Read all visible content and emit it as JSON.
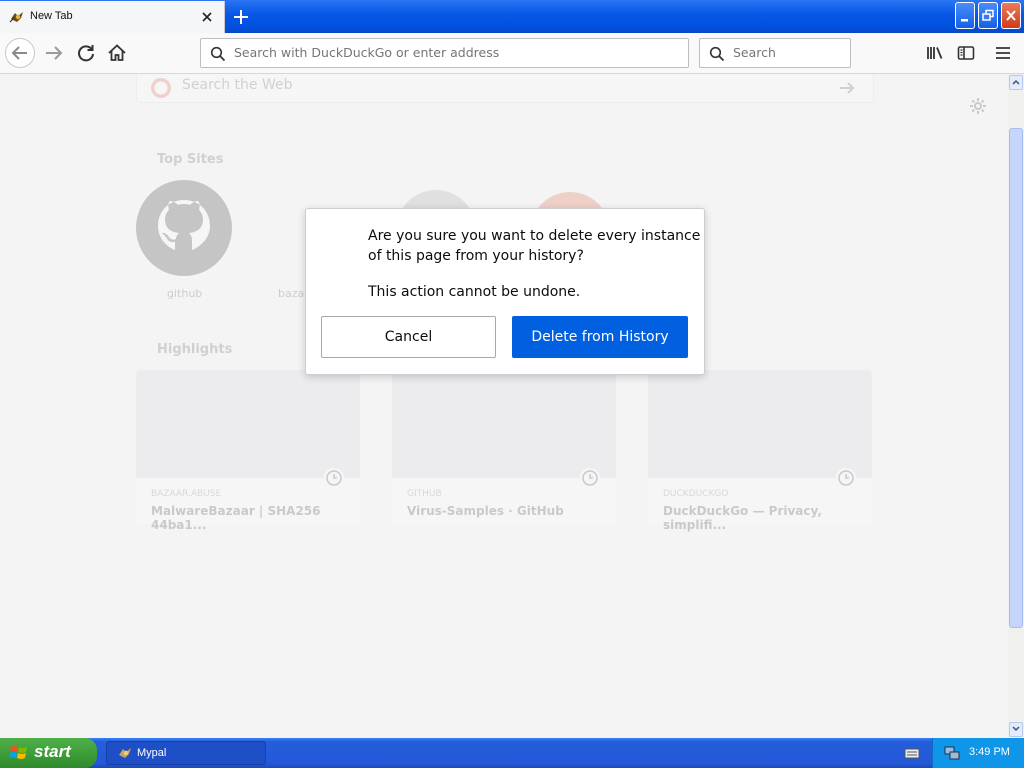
{
  "browser": {
    "tab_title": "New Tab",
    "url_placeholder": "Search with DuckDuckGo or enter address",
    "search_placeholder": "Search"
  },
  "newtab": {
    "search_placeholder": "Search the Web",
    "top_sites_title": "Top Sites",
    "top_sites": [
      "github",
      "bazaar"
    ],
    "highlights_title": "Highlights",
    "highlights": [
      {
        "source": "BAZAAR.ABUSE",
        "title": "MalwareBazaar | SHA256 44ba1..."
      },
      {
        "source": "GITHUB",
        "title": "Virus-Samples · GitHub"
      },
      {
        "source": "DUCKDUCKGO",
        "title": "DuckDuckGo — Privacy, simplifi..."
      }
    ]
  },
  "dialog": {
    "line1": "Are you sure you want to delete every instance",
    "line2": "of this page from your history?",
    "line3": "This action cannot be undone.",
    "cancel_label": "Cancel",
    "delete_label": "Delete from History"
  },
  "taskbar": {
    "start_label": "start",
    "task_label": "Mypal",
    "clock": "3:49 PM"
  },
  "colors": {
    "accent": "#0060df",
    "xp_blue": "#245edb",
    "start_green": "#3c9a36"
  }
}
